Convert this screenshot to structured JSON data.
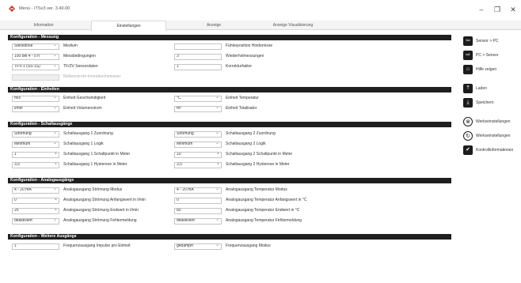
{
  "window": {
    "title": "Menü - ITSv3 ver. 3.40.00",
    "minimize": "–",
    "maximize": "❐",
    "close": "✕"
  },
  "tabs": [
    {
      "label": "Information",
      "active": false
    },
    {
      "label": "Einstellungen",
      "active": true
    },
    {
      "label": "Anzeige",
      "active": false
    },
    {
      "label": "Anzeige Visualisierung",
      "active": false
    }
  ],
  "sections": {
    "messung": {
      "title": "Konfiguration - Messung",
      "row1": {
        "select": "Steckdose",
        "label1": "Medium",
        "input": "",
        "label2": "Fühlerposition Hindernisse"
      },
      "row2": {
        "select": "100 bei 4 - 5 h",
        "label1": "Messbedingungen",
        "input": "3",
        "label2": "Wiederholmessungen"
      },
      "row3": {
        "select": "TFV-1 (SS-1S)",
        "label1": "TF/ZV Sensordaten",
        "input": "1",
        "label2": "Korrekturfaktor"
      },
      "row4": {
        "input": "",
        "label1": "Referenzrohr-Innendurchmesser"
      }
    },
    "einheiten": {
      "title": "Konfiguration - Einheiten",
      "row1": {
        "select1": "m/s",
        "label1": "Einheit Geschwindigkeit",
        "select2": "°C",
        "label2": "Einheit Temperatur"
      },
      "row2": {
        "select1": "l/min",
        "label1": "Einheit Volumenstrom",
        "select2": "m³",
        "label2": "Einheit Totalisator"
      }
    },
    "schaltausgang": {
      "title": "Konfiguration - Schaltausgänge",
      "row1": {
        "select1": "Strömung",
        "label1": "Schaltausgang 1 Zuordnung",
        "select2": "Strömung",
        "label2": "Schaltausgang 2 Zuordnung"
      },
      "row2": {
        "select1": "Minimum",
        "label1": "Schaltausgang 1 Logik",
        "select2": "Minimum",
        "label2": "Schaltausgang 2 Logik"
      },
      "row3": {
        "input1": "1",
        "label1": "Schaltausgang 1 Schaltpunkt in Meter",
        "input2": "10",
        "label2": "Schaltausgang 2 Schaltpunkt in Meter"
      },
      "row4": {
        "input1": "3,5",
        "label1": "Schaltausgang 1 Hysterese in Meter",
        "input2": "3,5",
        "label2": "Schaltausgang 2 Hysterese in Meter"
      }
    },
    "analog": {
      "title": "Konfiguration - Analogausgänge",
      "row1": {
        "select1": "4 - 20 mA",
        "label1": "Analogausgang Strömung Modus",
        "select2": "4 - 20 mA",
        "label2": "Analogausgang Temperatur Modus"
      },
      "row2": {
        "input1": "0",
        "label1": "Analogausgang Strömung Anfangswert in l/min",
        "input2": "0",
        "label2": "Analogausgang Temperatur Anfangswert in °C"
      },
      "row3": {
        "input1": "25",
        "label1": "Analogausgang Strömung Endwert in l/min",
        "input2": "80",
        "label2": "Analogausgang Temperatur Endwert in °C"
      },
      "row4": {
        "select1": "deaktiviert",
        "label1": "Analogausgang Strömung Fehlermeldung",
        "select2": "deaktiviert",
        "label2": "Analogausgang Temperatur Fehlermeldung"
      }
    },
    "weitere": {
      "title": "Konfiguration - Weitere Ausgänge",
      "row1": {
        "input1": "1",
        "label1": "Frequenzausgang Impulse pro Einheit",
        "select2": "gedämpft",
        "label2": "Frequenzausgang Modus"
      }
    }
  },
  "sidebar": [
    {
      "icon": "⇦",
      "label": "Sensor > PC",
      "round": false
    },
    {
      "icon": "⇨",
      "label": "PC > Sensor",
      "round": false
    },
    {
      "icon": "⌂",
      "label": "Hilfe zeigen",
      "round": false
    },
    {
      "icon": "⤒",
      "label": "Laden",
      "round": false
    },
    {
      "icon": "⤓",
      "label": "Speichern",
      "round": false
    },
    {
      "icon": "⊗",
      "label": "Werkseinstellungen",
      "round": true
    },
    {
      "icon": "↻",
      "label": "Werkseinstellungen",
      "round": true
    },
    {
      "icon": "✔",
      "label": "Kontrollinformationen",
      "round": false
    }
  ]
}
